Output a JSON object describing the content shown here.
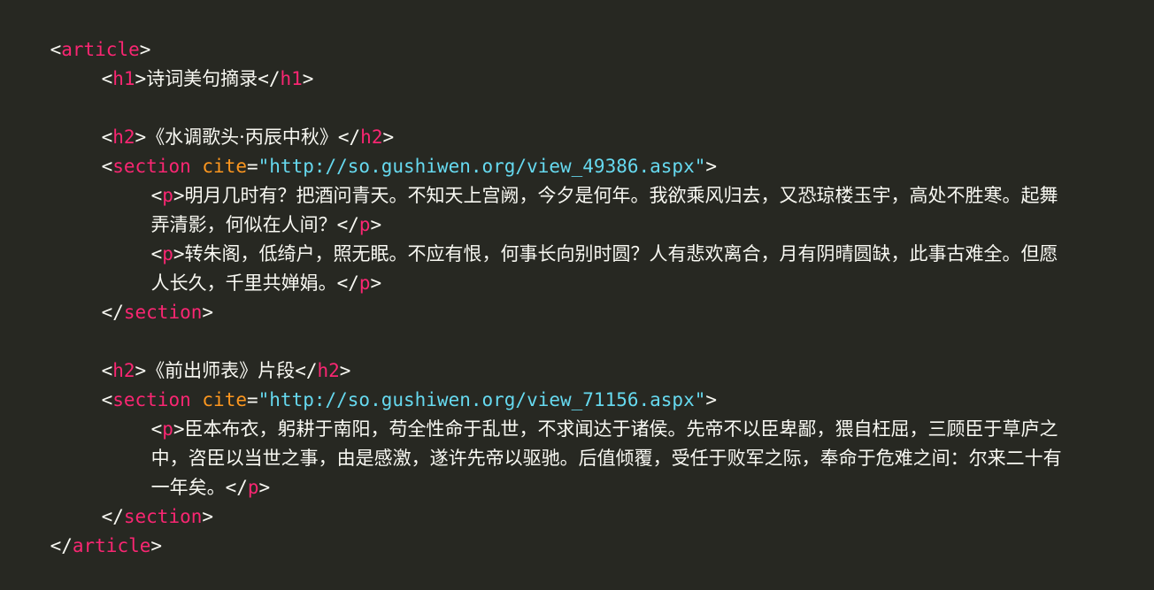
{
  "code": {
    "article_tag": "article",
    "h1_tag": "h1",
    "h1_text": "诗词美句摘录",
    "h2_tag": "h2",
    "section_tag": "section",
    "cite_attr": "cite",
    "p_tag": "p",
    "sections": [
      {
        "h2_text": "《水调歌头·丙辰中秋》",
        "cite_value": "\"http://so.gushiwen.org/view_49386.aspx\"",
        "paragraphs": [
          {
            "line1": "明月几时有？把酒问青天。不知天上宫阙，今夕是何年。我欲乘风归去，又恐琼楼玉宇，高处不胜寒。起舞",
            "line2": "弄清影，何似在人间？"
          },
          {
            "line1": "转朱阁，低绮户，照无眠。不应有恨，何事长向别时圆？人有悲欢离合，月有阴晴圆缺，此事古难全。但愿",
            "line2": "人长久，千里共婵娟。"
          }
        ]
      },
      {
        "h2_text": "《前出师表》片段",
        "cite_value": "\"http://so.gushiwen.org/view_71156.aspx\"",
        "paragraphs": [
          {
            "line1": "臣本布衣，躬耕于南阳，苟全性命于乱世，不求闻达于诸侯。先帝不以臣卑鄙，猥自枉屈，三顾臣于草庐之",
            "line2": "中，咨臣以当世之事，由是感激，遂许先帝以驱驰。后值倾覆，受任于败军之际，奉命于危难之间：尔来二十有",
            "line3": "一年矣。"
          }
        ]
      }
    ]
  }
}
